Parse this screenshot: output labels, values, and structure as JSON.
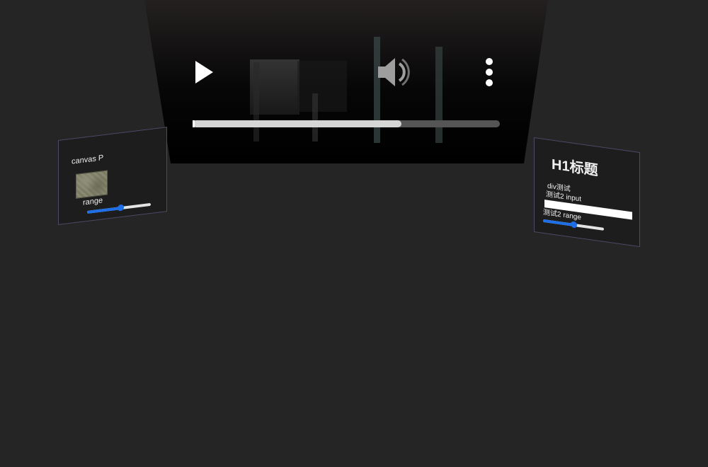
{
  "player": {
    "progress": 0.68,
    "icons": {
      "play": "play-icon",
      "volume": "speaker-icon",
      "more": "more-vertical-icon"
    },
    "colors": {
      "background": "#000000",
      "progress_fill": "#d6d6d6",
      "progress_track": "#555555",
      "icon": "#ffffff"
    }
  },
  "left_card": {
    "title": "canvas P",
    "range_label": "range",
    "range_value": 0.52,
    "colors": {
      "border": "#4d4a66",
      "range_fill": "#1c6fe6"
    }
  },
  "right_card": {
    "heading": "H1标题",
    "div_text": "div测试",
    "input_label": "测试2 input",
    "input_value": "",
    "range_label": "测试2 range",
    "range_value": 0.5
  }
}
